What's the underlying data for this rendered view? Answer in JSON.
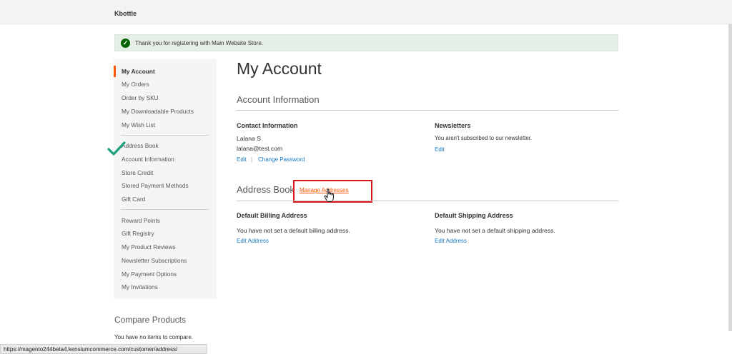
{
  "header": {
    "store_name": "Kbottle"
  },
  "message": {
    "text": "Thank you for registering with Main Website Store."
  },
  "sidebar": {
    "items": [
      {
        "label": "My Account",
        "active": true
      },
      {
        "label": "My Orders"
      },
      {
        "label": "Order by SKU"
      },
      {
        "label": "My Downloadable Products"
      },
      {
        "label": "My Wish List"
      },
      {
        "label": "Address Book"
      },
      {
        "label": "Account Information"
      },
      {
        "label": "Store Credit"
      },
      {
        "label": "Stored Payment Methods"
      },
      {
        "label": "Gift Card"
      },
      {
        "label": "Reward Points"
      },
      {
        "label": "Gift Registry"
      },
      {
        "label": "My Product Reviews"
      },
      {
        "label": "Newsletter Subscriptions"
      },
      {
        "label": "My Payment Options"
      },
      {
        "label": "My Invitations"
      }
    ]
  },
  "compare": {
    "title": "Compare Products",
    "text": "You have no items to compare."
  },
  "main": {
    "title": "My Account",
    "account_info": {
      "title": "Account Information",
      "contact": {
        "title": "Contact Information",
        "name": "Lalana S",
        "email": "lalana@test.com",
        "edit_label": "Edit",
        "separator": "|",
        "change_password_label": "Change Password"
      },
      "newsletters": {
        "title": "Newsletters",
        "text": "You aren't subscribed to our newsletter.",
        "edit_label": "Edit"
      }
    },
    "address_book": {
      "title": "Address Book",
      "manage_label": "Manage Addresses",
      "billing": {
        "title": "Default Billing Address",
        "text": "You have not set a default billing address.",
        "edit_label": "Edit Address"
      },
      "shipping": {
        "title": "Default Shipping Address",
        "text": "You have not set a default shipping address.",
        "edit_label": "Edit Address"
      }
    }
  },
  "status_bar": {
    "url": "https://magento244beta4.kensiumcommerce.com/customer/address/"
  },
  "colors": {
    "accent": "#ff5501",
    "link": "#1979c3",
    "highlight": "#d9141b",
    "success_bg": "#e5efe5",
    "check": "#1aa37a"
  },
  "icons": {
    "success": "check-circle-icon",
    "annotation": "green-checkmark-icon",
    "cursor": "hand-pointer-icon"
  }
}
